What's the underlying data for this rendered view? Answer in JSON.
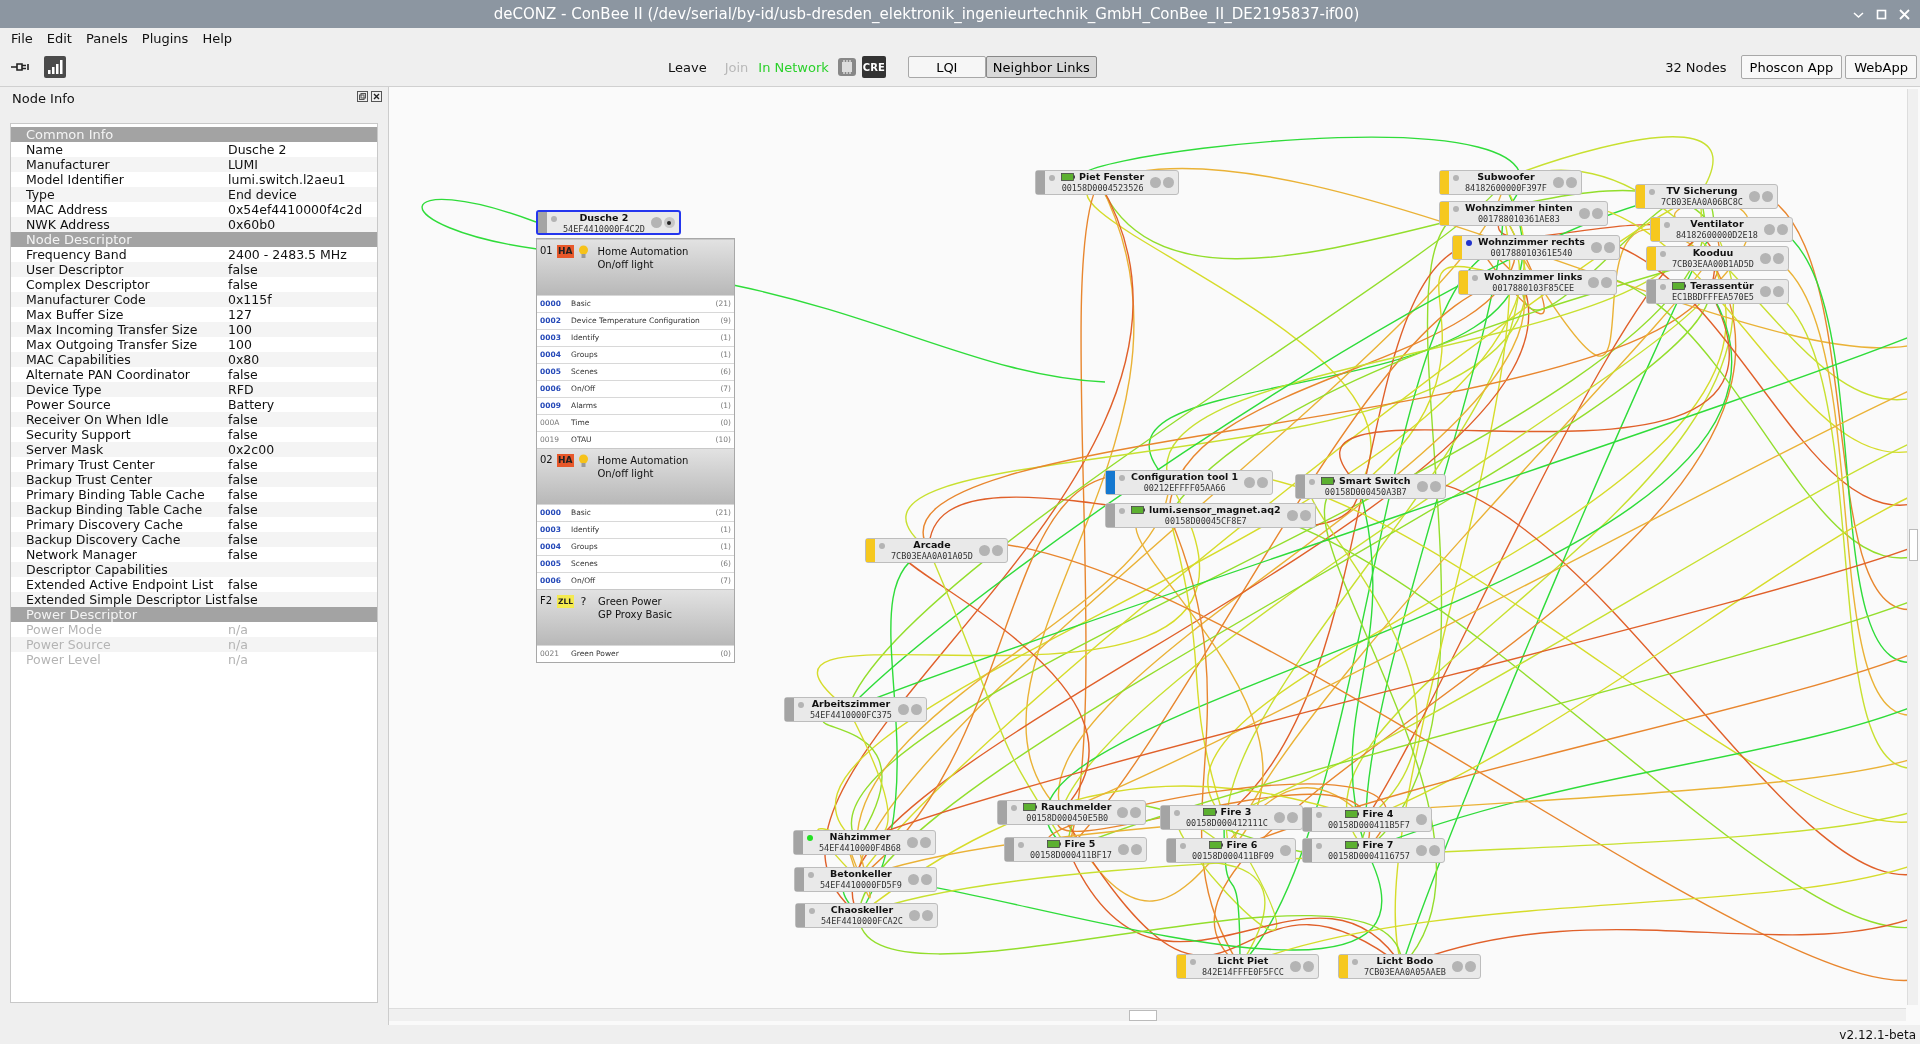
{
  "window": {
    "title": "deCONZ - ConBee II (/dev/serial/by-id/usb-dresden_elektronik_ingenieurtechnik_GmbH_ConBee_II_DE2195837-if00)"
  },
  "menu": [
    "File",
    "Edit",
    "Panels",
    "Plugins",
    "Help"
  ],
  "toolbar": {
    "leave": "Leave",
    "join": {
      "label": "Join",
      "disabled": true
    },
    "status": "In Network",
    "cre": "CRE",
    "view_buttons": [
      {
        "label": "LQI",
        "selected": false
      },
      {
        "label": "Neighbor Links",
        "selected": true
      }
    ],
    "node_count": "32 Nodes",
    "apps": [
      "Phoscon App",
      "WebApp"
    ]
  },
  "node_info": {
    "title": "Node Info",
    "sections": [
      {
        "title": "Common Info",
        "disabled": false,
        "rows": [
          {
            "label": "Name",
            "value": "Dusche 2"
          },
          {
            "label": "Manufacturer",
            "value": "LUMI"
          },
          {
            "label": "Model Identifier",
            "value": "lumi.switch.l2aeu1"
          },
          {
            "label": "Type",
            "value": "End device"
          },
          {
            "label": "MAC Address",
            "value": "0x54ef4410000f4c2d"
          },
          {
            "label": "NWK Address",
            "value": "0x60b0"
          }
        ]
      },
      {
        "title": "Node Descriptor",
        "disabled": false,
        "rows": [
          {
            "label": "Frequency Band",
            "value": "2400 - 2483.5 MHz"
          },
          {
            "label": "User Descriptor",
            "value": "false"
          },
          {
            "label": "Complex Descriptor",
            "value": "false"
          },
          {
            "label": "Manufacturer Code",
            "value": "0x115f"
          },
          {
            "label": "Max Buffer Size",
            "value": "127"
          },
          {
            "label": "Max Incoming Transfer Size",
            "value": "100"
          },
          {
            "label": "Max Outgoing Transfer Size",
            "value": "100"
          },
          {
            "label": "MAC Capabilities",
            "value": "0x80"
          },
          {
            "label": "Alternate PAN Coordinator",
            "value": "false"
          },
          {
            "label": "Device Type",
            "value": "RFD"
          },
          {
            "label": "Power Source",
            "value": "Battery"
          },
          {
            "label": "Receiver On When Idle",
            "value": "false"
          },
          {
            "label": "Security Support",
            "value": "false"
          },
          {
            "label": "Server Mask",
            "value": "0x2c00"
          },
          {
            "label": "Primary Trust Center",
            "value": "false"
          },
          {
            "label": "Backup Trust Center",
            "value": "false"
          },
          {
            "label": "Primary Binding Table Cache",
            "value": "false"
          },
          {
            "label": "Backup Binding Table Cache",
            "value": "false"
          },
          {
            "label": "Primary Discovery Cache",
            "value": "false"
          },
          {
            "label": "Backup Discovery Cache",
            "value": "false"
          },
          {
            "label": "Network Manager",
            "value": "false"
          },
          {
            "label": "Descriptor Capabilities"
          },
          {
            "label": "Extended Active Endpoint List",
            "value": "false"
          },
          {
            "label": "Extended Simple Descriptor List",
            "value": "false"
          }
        ]
      },
      {
        "title": "Power Descriptor",
        "disabled": true,
        "rows": [
          {
            "label": "Power Mode",
            "value": "n/a"
          },
          {
            "label": "Power Source",
            "value": "n/a"
          },
          {
            "label": "Power Level",
            "value": "n/a"
          }
        ]
      }
    ]
  },
  "nodes": [
    {
      "name": "Dusche 2",
      "address": "54EF4410000F4C2D",
      "kind": "end_device",
      "battery": false,
      "color": "#b4b4b4",
      "selected": true,
      "indicators": [
        {
          "on": false
        },
        {
          "on": true
        }
      ]
    },
    {
      "name": "Piet Fenster",
      "address": "00158D0004523526",
      "kind": "end_device",
      "battery": true,
      "color": "#b4b4b4",
      "selected": false,
      "indicators": [
        {
          "on": false
        },
        {
          "on": false
        }
      ]
    },
    {
      "name": "Subwoofer",
      "address": "84182600000F397F",
      "kind": "router",
      "battery": false,
      "color": "#b4b4b4",
      "selected": false,
      "indicators": [
        {
          "on": false
        },
        {
          "on": false
        }
      ]
    },
    {
      "name": "Wohnzimmer hinten",
      "address": "001788010361AE83",
      "kind": "router",
      "battery": false,
      "color": "#b4b4b4",
      "selected": false,
      "indicators": [
        {
          "on": false
        },
        {
          "on": false
        }
      ]
    },
    {
      "name": "Wohnzimmer rechts",
      "address": "001788010361E540",
      "kind": "router",
      "battery": false,
      "color": "#2233cc",
      "selected": false,
      "indicators": [
        {
          "on": false
        },
        {
          "on": false
        }
      ]
    },
    {
      "name": "Wohnzimmer links",
      "address": "0017880103F85CEE",
      "kind": "router",
      "battery": false,
      "color": "#b4b4b4",
      "selected": false,
      "indicators": [
        {
          "on": false
        },
        {
          "on": false
        }
      ]
    },
    {
      "name": "TV Sicherung",
      "address": "7CB03EAA0A06BC8C",
      "kind": "router",
      "battery": false,
      "color": "#b4b4b4",
      "selected": false,
      "indicators": [
        {
          "on": false
        },
        {
          "on": false
        }
      ]
    },
    {
      "name": "Ventilator",
      "address": "84182600000D2E18",
      "kind": "router",
      "battery": false,
      "color": "#b4b4b4",
      "selected": false,
      "indicators": [
        {
          "on": false
        },
        {
          "on": false
        }
      ]
    },
    {
      "name": "Kooduu",
      "address": "7CB03EAA00B1AD5D",
      "kind": "router",
      "battery": false,
      "color": "#b4b4b4",
      "selected": false,
      "indicators": [
        {
          "on": false
        },
        {
          "on": false
        }
      ]
    },
    {
      "name": "Terassentür",
      "address": "EC1BBDFFFEA570E5",
      "kind": "end_device",
      "battery": true,
      "color": "#b4b4b4",
      "selected": false,
      "indicators": [
        {
          "on": false
        },
        {
          "on": false
        }
      ]
    },
    {
      "name": "Configuration tool 1",
      "address": "00212EFFFF05AA66",
      "kind": "coordinator",
      "battery": false,
      "color": "#b4b4b4",
      "selected": false,
      "indicators": [
        {
          "on": false
        },
        {
          "on": false
        }
      ]
    },
    {
      "name": "Smart Switch",
      "address": "00158D000450A3B7",
      "kind": "end_device",
      "battery": true,
      "color": "#b4b4b4",
      "selected": false,
      "indicators": [
        {
          "on": false
        },
        {
          "on": false
        }
      ]
    },
    {
      "name": "lumi.sensor_magnet.aq2",
      "address": "00158D00045CF8E7",
      "kind": "end_device",
      "battery": true,
      "color": "#b4b4b4",
      "selected": false,
      "indicators": [
        {
          "on": false
        },
        {
          "on": false
        }
      ]
    },
    {
      "name": "Arcade",
      "address": "7CB03EAA0A01A05D",
      "kind": "router",
      "battery": false,
      "color": "#b4b4b4",
      "selected": false,
      "indicators": [
        {
          "on": false
        },
        {
          "on": false
        }
      ]
    },
    {
      "name": "Arbeitszimmer",
      "address": "54EF4410000FC375",
      "kind": "end_device",
      "battery": false,
      "color": "#b4b4b4",
      "selected": false,
      "indicators": [
        {
          "on": false
        },
        {
          "on": false
        }
      ]
    },
    {
      "name": "Rauchmelder",
      "address": "00158D000450E5B0",
      "kind": "end_device",
      "battery": true,
      "color": "#b4b4b4",
      "selected": false,
      "indicators": [
        {
          "on": false
        },
        {
          "on": false
        }
      ]
    },
    {
      "name": "Fire 3",
      "address": "00158D000412111C",
      "kind": "end_device",
      "battery": true,
      "color": "#b4b4b4",
      "selected": false,
      "indicators": [
        {
          "on": false
        },
        {
          "on": false
        }
      ]
    },
    {
      "name": "Fire 4",
      "address": "00158D000411B5F7",
      "kind": "end_device",
      "battery": true,
      "color": "#b4b4b4",
      "selected": false,
      "indicators": [
        {
          "on": false
        }
      ]
    },
    {
      "name": "Nähzimmer",
      "address": "54EF4410000F4B68",
      "kind": "end_device",
      "battery": false,
      "color": "#22e022",
      "selected": false,
      "indicators": [
        {
          "on": false
        },
        {
          "on": false
        }
      ]
    },
    {
      "name": "Fire 5",
      "address": "00158D000411BF17",
      "kind": "end_device",
      "battery": true,
      "color": "#b4b4b4",
      "selected": false,
      "indicators": [
        {
          "on": false
        },
        {
          "on": false
        }
      ]
    },
    {
      "name": "Fire 6",
      "address": "00158D000411BF09",
      "kind": "end_device",
      "battery": true,
      "color": "#b4b4b4",
      "selected": false,
      "indicators": [
        {
          "on": false
        }
      ]
    },
    {
      "name": "Fire 7",
      "address": "00158D0004116757",
      "kind": "end_device",
      "battery": true,
      "color": "#b4b4b4",
      "selected": false,
      "indicators": [
        {
          "on": false
        },
        {
          "on": false
        }
      ]
    },
    {
      "name": "Betonkeller",
      "address": "54EF4410000FD5F9",
      "kind": "end_device",
      "battery": false,
      "color": "#b4b4b4",
      "selected": false,
      "indicators": [
        {
          "on": false
        },
        {
          "on": false
        }
      ]
    },
    {
      "name": "Chaoskeller",
      "address": "54EF4410000FCA2C",
      "kind": "end_device",
      "battery": false,
      "color": "#b4b4b4",
      "selected": false,
      "indicators": [
        {
          "on": false
        },
        {
          "on": false
        }
      ]
    },
    {
      "name": "Licht Piet",
      "address": "842E14FFFE0F5FCC",
      "kind": "router",
      "battery": false,
      "color": "#b4b4b4",
      "selected": false,
      "indicators": [
        {
          "on": false
        },
        {
          "on": false
        }
      ]
    },
    {
      "name": "Licht Bodo",
      "address": "7CB03EAA0A05AAEB",
      "kind": "router",
      "battery": false,
      "color": "#b4b4b4",
      "selected": false,
      "indicators": [
        {
          "on": false
        },
        {
          "on": false
        }
      ]
    }
  ],
  "endpoints": [
    {
      "id": "01",
      "profile": {
        "kind": "ha",
        "label": "HA"
      },
      "device": {
        "kind": "bulb"
      },
      "title": "Home Automation",
      "subtitle": "On/off light",
      "clusters": [
        {
          "id": "0000",
          "name": "Basic",
          "count": "(21)",
          "active": true
        },
        {
          "id": "0002",
          "name": "Device Temperature Configuration",
          "count": "(9)",
          "active": true
        },
        {
          "id": "0003",
          "name": "Identify",
          "count": "(1)",
          "active": true
        },
        {
          "id": "0004",
          "name": "Groups",
          "count": "(1)",
          "active": true
        },
        {
          "id": "0005",
          "name": "Scenes",
          "count": "(6)",
          "active": true
        },
        {
          "id": "0006",
          "name": "On/Off",
          "count": "(7)",
          "active": true
        },
        {
          "id": "0009",
          "name": "Alarms",
          "count": "(1)",
          "active": true
        },
        {
          "id": "000A",
          "name": "Time",
          "count": "(0)",
          "active": false
        },
        {
          "id": "0019",
          "name": "OTAU",
          "count": "(10)",
          "active": false
        }
      ]
    },
    {
      "id": "02",
      "profile": {
        "kind": "ha",
        "label": "HA"
      },
      "device": {
        "kind": "bulb"
      },
      "title": "Home Automation",
      "subtitle": "On/off light",
      "clusters": [
        {
          "id": "0000",
          "name": "Basic",
          "count": "(21)",
          "active": true
        },
        {
          "id": "0003",
          "name": "Identify",
          "count": "(1)",
          "active": true
        },
        {
          "id": "0004",
          "name": "Groups",
          "count": "(1)",
          "active": true
        },
        {
          "id": "0005",
          "name": "Scenes",
          "count": "(6)",
          "active": true
        },
        {
          "id": "0006",
          "name": "On/Off",
          "count": "(7)",
          "active": true
        }
      ]
    },
    {
      "id": "F2",
      "profile": {
        "kind": "zll",
        "label": "ZLL"
      },
      "device": {
        "kind": "unknown",
        "glyph": "?"
      },
      "title": "Green Power",
      "subtitle": "GP Proxy Basic",
      "clusters": [
        {
          "id": "0021",
          "name": "Green Power",
          "count": "(0)",
          "active": false
        }
      ]
    }
  ],
  "status_bar": {
    "version": "v2.12.1-beta"
  }
}
